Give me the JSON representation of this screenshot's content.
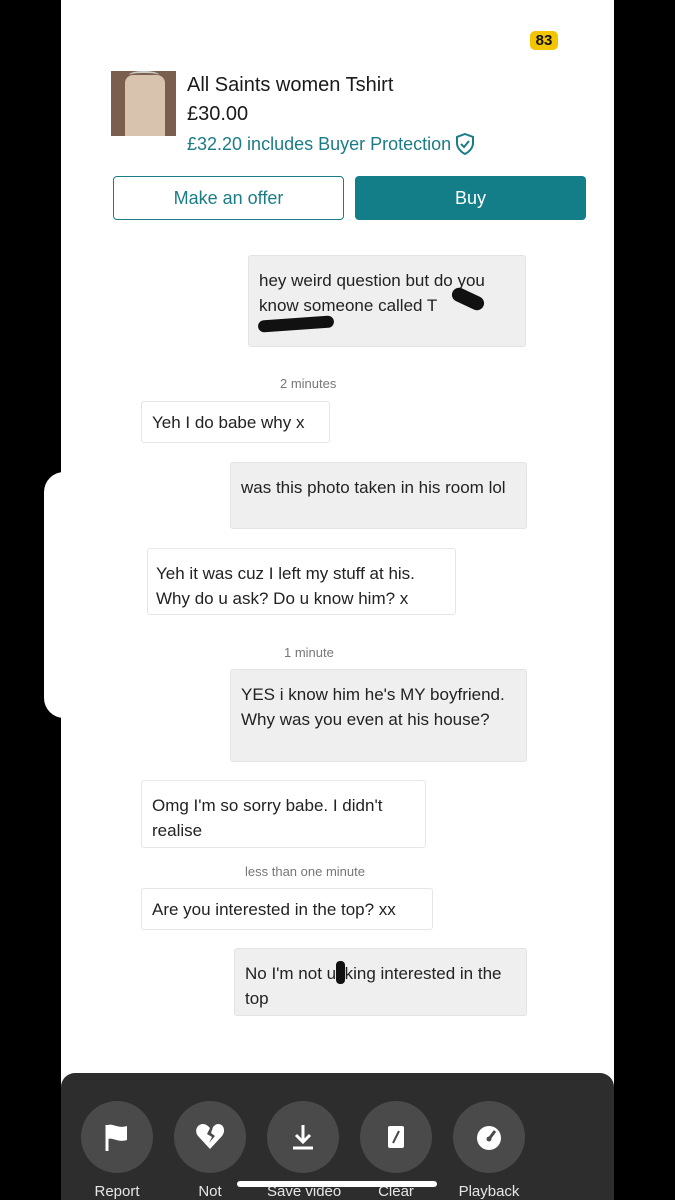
{
  "header": {
    "counter": "83",
    "item_title": "All Saints women Tshirt",
    "price": "£30.00",
    "protection": "£32.20 includes Buyer Protection",
    "offer_label": "Make an offer",
    "buy_label": "Buy"
  },
  "messages": [
    {
      "dir": "out",
      "text": "hey weird question but do you know someone called T"
    },
    {
      "dir": "time",
      "text": "2 minutes"
    },
    {
      "dir": "in",
      "text": "Yeh I do babe why x"
    },
    {
      "dir": "out",
      "text": "was this photo taken in his room lol"
    },
    {
      "dir": "in",
      "text": "Yeh it was cuz I left my stuff at his. Why do u ask? Do u know him? x"
    },
    {
      "dir": "time",
      "text": "1 minute"
    },
    {
      "dir": "out",
      "text": "YES i know him he's MY boyfriend. Why was you even at his house?"
    },
    {
      "dir": "in",
      "text": "Omg I'm so sorry babe. I didn't realise"
    },
    {
      "dir": "time",
      "text": "less than one minute"
    },
    {
      "dir": "in",
      "text": "Are you interested in the top? xx"
    },
    {
      "dir": "out",
      "text": "No I'm not ucking interested in the top"
    }
  ],
  "toolbar": {
    "items": [
      {
        "label": "Report",
        "icon": "flag-icon"
      },
      {
        "label": "Not",
        "icon": "broken-heart-icon"
      },
      {
        "label": "Save video",
        "icon": "download-icon"
      },
      {
        "label": "Clear",
        "icon": "eraser-icon"
      },
      {
        "label": "Playback",
        "icon": "speedometer-icon"
      }
    ]
  },
  "colors": {
    "accent": "#137e88",
    "counter_badge": "#f2c500",
    "toolbar_bg": "#2d2d2d"
  }
}
